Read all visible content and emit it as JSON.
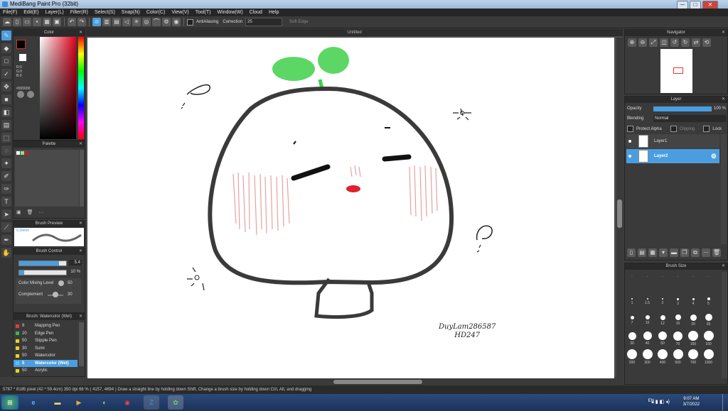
{
  "window": {
    "title": "MediBang Paint Pro (32bit)",
    "minimize": "─",
    "maximize": "□",
    "close": "✕"
  },
  "menu": [
    "File(F)",
    "Edit(E)",
    "Layer(L)",
    "Filter(R)",
    "Select(S)",
    "Snap(N)",
    "Color(C)",
    "View(V)",
    "Tool(T)",
    "Window(W)",
    "Cloud",
    "Help"
  ],
  "toolbar": {
    "antialiasing_label": "AntiAliasing",
    "correction_label": "Correction",
    "correction_value": "25",
    "soft_edge_label": "Soft Edge"
  },
  "document": {
    "tab_title": "Untitled",
    "watermark_line1": "DuyLam286587",
    "watermark_line2": "HD247"
  },
  "color_panel": {
    "title": "Color",
    "r": "R:0",
    "g": "G:0",
    "b": "B:0",
    "hex": "#000000"
  },
  "palette_panel": {
    "title": "Palette",
    "more": "···"
  },
  "brush_preview": {
    "title": "Brush Preview",
    "size": "0.39mm"
  },
  "brush_control": {
    "title": "Brush Control",
    "size_value": "5.4",
    "size_fraction": 0.85,
    "opacity_value": "10 %",
    "opacity_fraction": 0.1,
    "mixing_label": "Color Mixing Level",
    "mixing_value": "50",
    "complement_label": "Complement",
    "complement_value": "30"
  },
  "brush_list": {
    "title": "Brush: Watercolor (Wet)",
    "items": [
      {
        "size": "8",
        "name": "Mapping Pen",
        "color": "#e33b3b",
        "selected": false
      },
      {
        "size": "20",
        "name": "Edge Pen",
        "color": "#3fb548",
        "selected": false
      },
      {
        "size": "50",
        "name": "Stipple Pen",
        "color": "#e8d41c",
        "selected": false
      },
      {
        "size": "30",
        "name": "Sumi",
        "color": "#e8d41c",
        "selected": false
      },
      {
        "size": "50",
        "name": "Watercolor",
        "color": "#e8d41c",
        "selected": false
      },
      {
        "size": "5",
        "name": "Watercolor (Wet)",
        "color": "#5bc3ee",
        "selected": true
      },
      {
        "size": "50",
        "name": "Acrylic",
        "color": "#e8d41c",
        "selected": false
      }
    ]
  },
  "navigator": {
    "title": "Navigator"
  },
  "layer_panel": {
    "title": "Layer",
    "opacity_label": "Opacity",
    "opacity_value": "100 %",
    "blending_label": "Blending",
    "blending_value": "Normal",
    "protect_alpha": "Protect Alpha",
    "clipping": "Clipping",
    "lock": "Lock",
    "layers": [
      {
        "name": "Layer1",
        "selected": false
      },
      {
        "name": "Layer2",
        "selected": true
      }
    ]
  },
  "brush_size": {
    "title": "Brush Size",
    "rows": [
      [
        "·",
        "·",
        "·",
        "·",
        "·",
        "·"
      ],
      [
        "1",
        "1.5",
        "2",
        "3",
        "4",
        "5"
      ],
      [
        "7",
        "10",
        "12",
        "15",
        "20",
        "25"
      ],
      [
        "30",
        "40",
        "50",
        "70",
        "100",
        "150"
      ],
      [
        "200",
        "300",
        "400",
        "500",
        "700",
        "1000"
      ]
    ]
  },
  "status": {
    "text": "5787 * 8185 pixel   (42 * 59.4cm)   350 dpi   66 %   ( 4157, 4694 )   Draw a straight line by holding down Shift, Change a brush size by holding down Ctrl, Alt, and dragging"
  },
  "taskbar": {
    "lang": "EN",
    "time": "9:07 AM",
    "date": "3/7/2022"
  },
  "colors": {
    "accent": "#4a9ee0",
    "sprout": "#3fd04a",
    "blush": "#e8a0a0",
    "mouth": "#e0202a",
    "ink": "#333333"
  }
}
